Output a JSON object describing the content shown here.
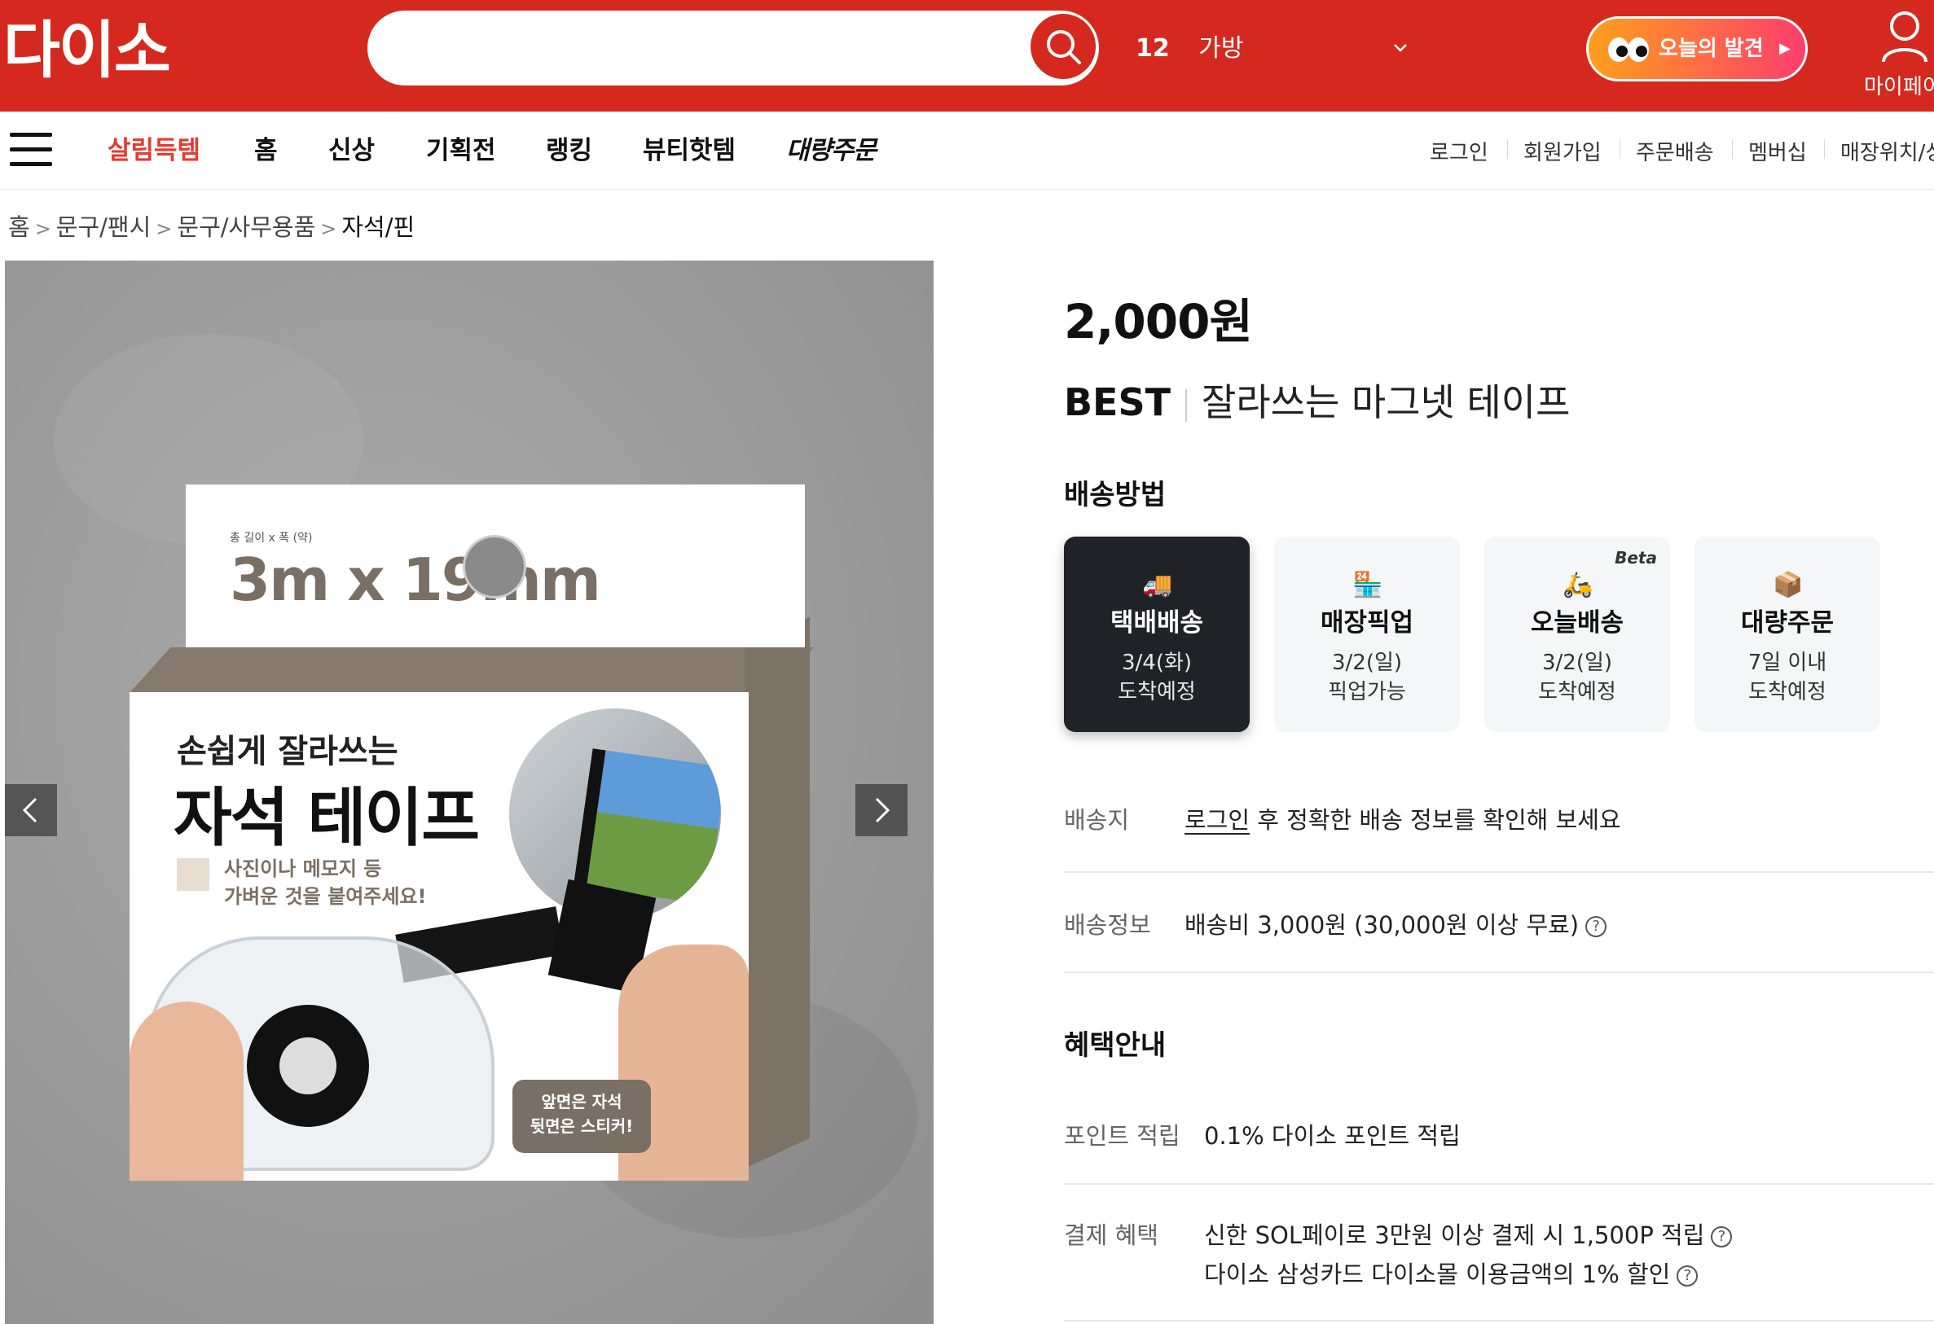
{
  "header": {
    "logo": "다이소",
    "search": {
      "value": "",
      "placeholder": ""
    },
    "region": {
      "number": "12",
      "name": "가방"
    },
    "discover_label": "오늘의 발견",
    "mypage_label": "마이페이"
  },
  "nav": {
    "items": [
      "살림득템",
      "홈",
      "신상",
      "기획전",
      "랭킹",
      "뷰티핫템",
      "대량주문"
    ],
    "utilities": [
      "로그인",
      "회원가입",
      "주문배송",
      "멤버십",
      "매장위치/상"
    ]
  },
  "breadcrumb": [
    "홈",
    "문구/팬시",
    "문구/사무용품",
    "자석/핀"
  ],
  "product_image": {
    "size_caption": "총 길이 x 폭 (약)",
    "size_value": "3m x 19mm",
    "headline_small": "손쉽게 잘라쓰는",
    "headline_large": "자석 테이프",
    "note_line1": "사진이나 메모지 등",
    "note_line2": "가벼운 것을 붙여주세요!",
    "bubble_line1": "앞면은 자석",
    "bubble_line2": "뒷면은 스티커!"
  },
  "product": {
    "price": "2,000원",
    "badge": "BEST",
    "title": "잘라쓰는 마그넷 테이프"
  },
  "shipping": {
    "heading": "배송방법",
    "options": [
      {
        "icon": "truck-icon",
        "name": "택배배송",
        "line1": "3/4(화)",
        "line2": "도착예정",
        "active": true
      },
      {
        "icon": "store-icon",
        "name": "매장픽업",
        "line1": "3/2(일)",
        "line2": "픽업가능",
        "active": false
      },
      {
        "icon": "scooter-icon",
        "name": "오늘배송",
        "line1": "3/2(일)",
        "line2": "도착예정",
        "badge": "Beta",
        "active": false
      },
      {
        "icon": "box-icon",
        "name": "대량주문",
        "line1": "7일 이내",
        "line2": "도착예정",
        "active": false
      }
    ],
    "destination_label": "배송지",
    "destination_link": "로그인",
    "destination_text": " 후 정확한 배송 정보를 확인해 보세요",
    "info_label": "배송정보",
    "info_text": "배송비 3,000원 (30,000원 이상 무료)"
  },
  "benefits": {
    "heading": "혜택안내",
    "point_label": "포인트 적립",
    "point_text": "0.1% 다이소 포인트 적립",
    "payment_label": "결제 혜택",
    "payment_line1": "신한 SOL페이로 3만원 이상 결제 시 1,500P 적립",
    "payment_line2": "다이소 삼성카드 다이소몰 이용금액의 1% 할인"
  },
  "colors": {
    "brand_red": "#d5291f",
    "highlight_red": "#e8392f",
    "active_card": "#1f2226"
  }
}
